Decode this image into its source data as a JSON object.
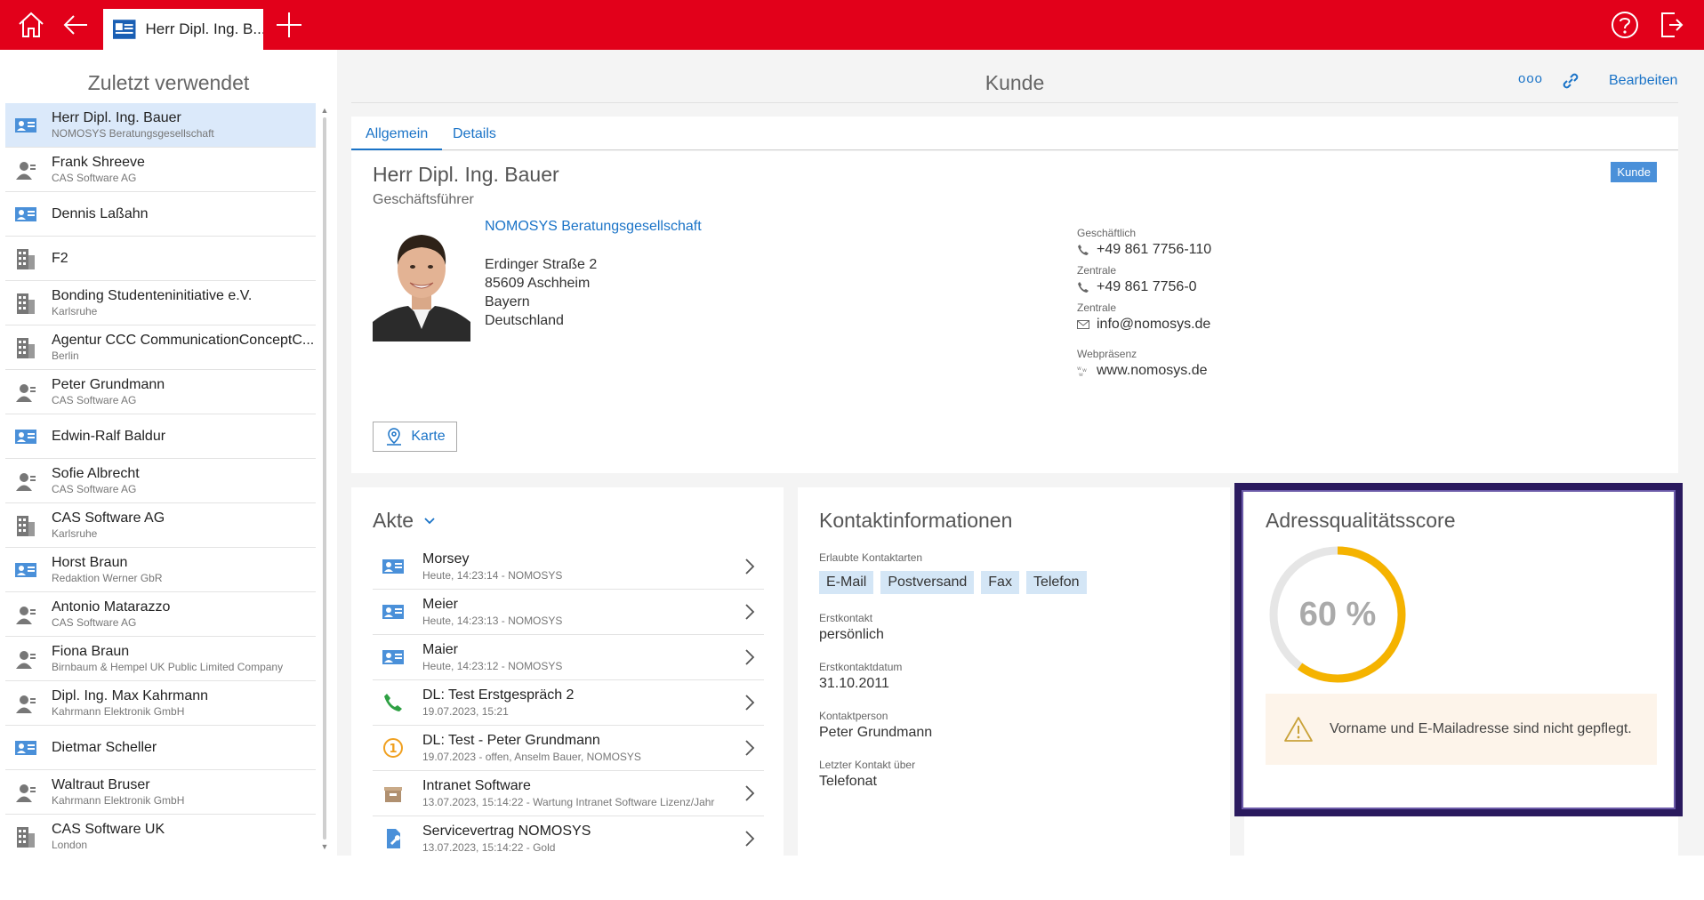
{
  "topbar": {
    "tab_label": "Herr Dipl. Ing. B...",
    "colors": {
      "bar": "#e2001a"
    }
  },
  "left": {
    "title": "Zuletzt verwendet",
    "items": [
      {
        "name": "Herr Dipl. Ing. Bauer",
        "sub": "NOMOSYS Beratungsgesellschaft",
        "icon": "contact-card-person-icon",
        "active": true
      },
      {
        "name": "Frank Shreeve",
        "sub": "CAS Software AG",
        "icon": "person-icon"
      },
      {
        "name": "Dennis Laßahn",
        "sub": "",
        "icon": "contact-card-icon"
      },
      {
        "name": "F2",
        "sub": "",
        "icon": "building-icon"
      },
      {
        "name": "Bonding Studenteninitiative e.V.",
        "sub": "Karlsruhe",
        "icon": "building-icon"
      },
      {
        "name": "Agentur CCC CommunicationConceptC...",
        "sub": "Berlin",
        "icon": "building-icon"
      },
      {
        "name": "Peter Grundmann",
        "sub": "CAS Software AG",
        "icon": "person-icon"
      },
      {
        "name": "Edwin-Ralf Baldur",
        "sub": "",
        "icon": "contact-card-icon"
      },
      {
        "name": "Sofie Albrecht",
        "sub": "CAS Software AG",
        "icon": "person-icon"
      },
      {
        "name": "CAS Software AG",
        "sub": "Karlsruhe",
        "icon": "building-icon"
      },
      {
        "name": "Horst Braun",
        "sub": "Redaktion Werner GbR",
        "icon": "contact-card-icon"
      },
      {
        "name": "Antonio Matarazzo",
        "sub": "CAS Software AG",
        "icon": "person-icon"
      },
      {
        "name": "Fiona Braun",
        "sub": "Birnbaum & Hempel UK Public Limited Company",
        "icon": "person-icon"
      },
      {
        "name": "Dipl. Ing. Max Kahrmann",
        "sub": "Kahrmann Elektronik GmbH",
        "icon": "person-icon"
      },
      {
        "name": "Dietmar Scheller",
        "sub": "",
        "icon": "contact-card-icon"
      },
      {
        "name": "Waltraut Bruser",
        "sub": "Kahrmann Elektronik GmbH",
        "icon": "person-icon"
      },
      {
        "name": "CAS Software UK",
        "sub": "London",
        "icon": "building-icon"
      }
    ]
  },
  "header": {
    "title": "Kunde",
    "more_label": "ooo",
    "edit_label": "Bearbeiten"
  },
  "tabs": [
    {
      "label": "Allgemein",
      "active": true
    },
    {
      "label": "Details",
      "active": false
    }
  ],
  "contact": {
    "name": "Herr Dipl. Ing. Bauer",
    "role": "Geschäftsführer",
    "badge": "Kunde",
    "company": "NOMOSYS Beratungsgesellschaft",
    "address": {
      "street": "Erdinger Straße 2",
      "city": "85609 Aschheim",
      "state": "Bayern",
      "country": "Deutschland"
    },
    "channels": [
      {
        "label": "Geschäftlich",
        "value": "+49 861 7756-110",
        "icon": "phone-icon"
      },
      {
        "label": "Zentrale",
        "value": "+49 861 7756-0",
        "icon": "phone-icon"
      },
      {
        "label": "Zentrale",
        "value": "info@nomosys.de",
        "icon": "mail-icon"
      },
      {
        "label": "Webpräsenz",
        "value": "www.nomosys.de",
        "icon": "www-icon"
      }
    ],
    "map_button": "Karte"
  },
  "akte": {
    "title": "Akte",
    "items": [
      {
        "name": "Morsey",
        "sub": "Heute, 14:23:14 - NOMOSYS",
        "icon": "contact-card-icon"
      },
      {
        "name": "Meier",
        "sub": "Heute, 14:23:13 - NOMOSYS",
        "icon": "contact-card-icon"
      },
      {
        "name": "Maier",
        "sub": "Heute, 14:23:12 - NOMOSYS",
        "icon": "contact-card-icon"
      },
      {
        "name": "DL: Test Erstgespräch 2",
        "sub": "19.07.2023, 15:21",
        "icon": "phone-call-icon"
      },
      {
        "name": "DL: Test - Peter Grundmann",
        "sub": "19.07.2023 - offen, Anselm Bauer, NOMOSYS",
        "icon": "task-priority-icon"
      },
      {
        "name": "Intranet Software",
        "sub": "13.07.2023, 15:14:22 - Wartung Intranet Software Lizenz/Jahr",
        "icon": "product-box-icon"
      },
      {
        "name": "Servicevertrag NOMOSYS",
        "sub": "13.07.2023, 15:14:22 - Gold",
        "icon": "contract-wrench-icon"
      }
    ]
  },
  "kontakt": {
    "title": "Kontaktinformationen",
    "allowed_label": "Erlaubte Kontaktarten",
    "allowed": [
      "E-Mail",
      "Postversand",
      "Fax",
      "Telefon"
    ],
    "fields": [
      {
        "label": "Erstkontakt",
        "value": "persönlich"
      },
      {
        "label": "Erstkontaktdatum",
        "value": "31.10.2011"
      },
      {
        "label": "Kontaktperson",
        "value": "Peter Grundmann"
      },
      {
        "label": "Letzter Kontakt über",
        "value": "Telefonat"
      }
    ]
  },
  "score": {
    "title": "Adressqualitätsscore",
    "value": 60,
    "value_label": "60 %",
    "warning": "Vorname und E-Mailadresse sind nicht gepflegt.",
    "colors": {
      "ring": "#f5b300",
      "track": "#e6e6e6",
      "highlight": "#2a1a5e"
    }
  }
}
